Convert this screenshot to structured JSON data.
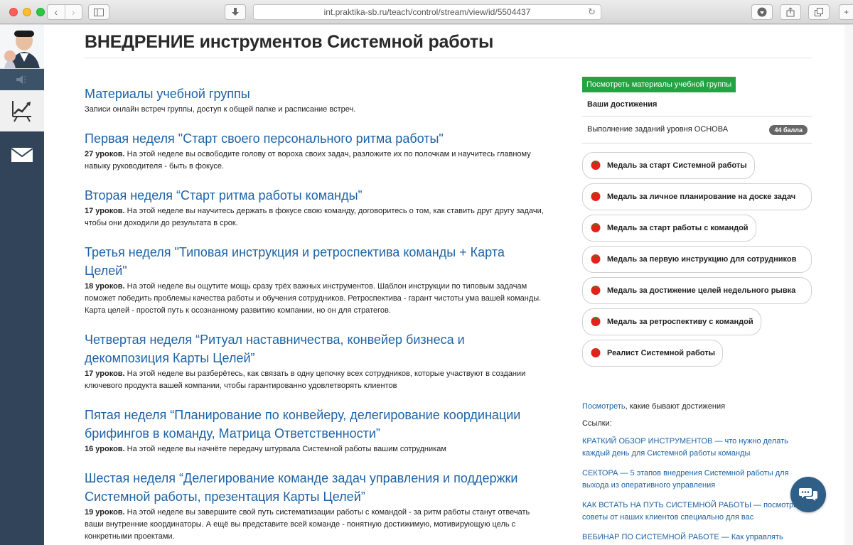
{
  "browser": {
    "url": "int.praktika-sb.ru/teach/control/stream/view/id/5504437"
  },
  "page": {
    "title": "ВНЕДРЕНИЕ инструментов Системной работы"
  },
  "lessons": [
    {
      "title": "Материалы учебной группы",
      "count": "",
      "description": "Записи онлайн встреч группы, доступ к общей папке и расписание встреч."
    },
    {
      "title": "Первая неделя \"Старт своего персонального ритма работы\"",
      "count": "27 уроков.",
      "description": " На этой неделе вы освободите голову от вороха своих задач, разложите их по полочкам и научитесь главному навыку руководителя - быть в фокусе."
    },
    {
      "title": "Вторая неделя “Старт ритма работы команды”",
      "count": "17 уроков.",
      "description": " На этой неделе вы научитесь держать в фокусе свою команду, договоритесь о том, как ставить друг другу задачи, чтобы они доходили до результата в срок."
    },
    {
      "title": "Третья неделя \"Типовая инструкция и ретроспектива команды + Карта Целей\"",
      "count": "18 уроков.",
      "description": " На этой неделе вы ощутите мощь сразу трёх важных инструментов. Шаблон инструкции по типовым задачам поможет победить проблемы качества работы и обучения сотрудников. Ретроспектива - гарант чистоты ума вашей команды. Карта целей - простой путь к осознанному развитию компании, но он для стратегов."
    },
    {
      "title": "Четвертая неделя “Ритуал наставничества, конвейер бизнеса и декомпозиция Карты Целей”",
      "count": "17 уроков.",
      "description": " На этой неделе вы разберётесь, как связать в одну цепочку всех сотрудников, которые участвуют в создании ключевого продукта вашей компании, чтобы гарантированно удовлетворять клиентов"
    },
    {
      "title": "Пятая неделя “Планирование по конвейеру, делегирование координации брифингов в команду, Матрица Ответственности”",
      "count": "16 уроков.",
      "description": " На этой неделе вы начнёте передачу штурвала Системной работы вашим сотрудникам"
    },
    {
      "title": "Шестая неделя “Делегирование команде задач управления и поддержки Системной работы, презентация Карты Целей”",
      "count": "19 уроков.",
      "description": " На этой неделе вы завершите свой путь систематизации работы с командой - за ритм работы станут отвечать ваши внутренние координаторы. А ещё вы представите всей команде - понятную достижимую, мотивирующую цель с конкретными проектами."
    }
  ],
  "right": {
    "materials_button": "Посмотреть материалы учебной группы",
    "achievements_heading": "Ваши достижения",
    "level_label": "Выполнение заданий уровня ОСНОВА",
    "level_badge": "44 балла",
    "medals": [
      "Медаль за старт Системной работы",
      "Медаль за личное планирование на доске задач",
      "Медаль за старт работы с командой",
      "Медаль за первую инструкцию для сотрудников",
      "Медаль за достижение целей недельного рывка",
      "Медаль за ретроспективу с командой",
      "Реалист Системной работы"
    ],
    "see_link": "Посмотреть",
    "see_text": ", какие бывают достижения",
    "links_heading": "Ссылки:",
    "links": [
      "КРАТКИЙ ОБЗОР ИНСТРУМЕНТОВ — что нужно делать каждый день для Системной работы команды",
      "СЕКТОРА — 5 этапов внедрения Системной работы для выхода из оперативного управления",
      "КАК ВСТАТЬ НА ПУТЬ СИСТЕМНОЙ РАБОТЫ — посмотрите советы от наших клиентов специально для вас",
      "ВЕБИНАР ПО СИСТЕМНОЙ РАБОТЕ — Как управлять"
    ]
  },
  "colors": {
    "link": "#1d63a6",
    "green_button": "#23a342",
    "sidebar": "#31445a",
    "chat_button": "#2f5e87"
  }
}
